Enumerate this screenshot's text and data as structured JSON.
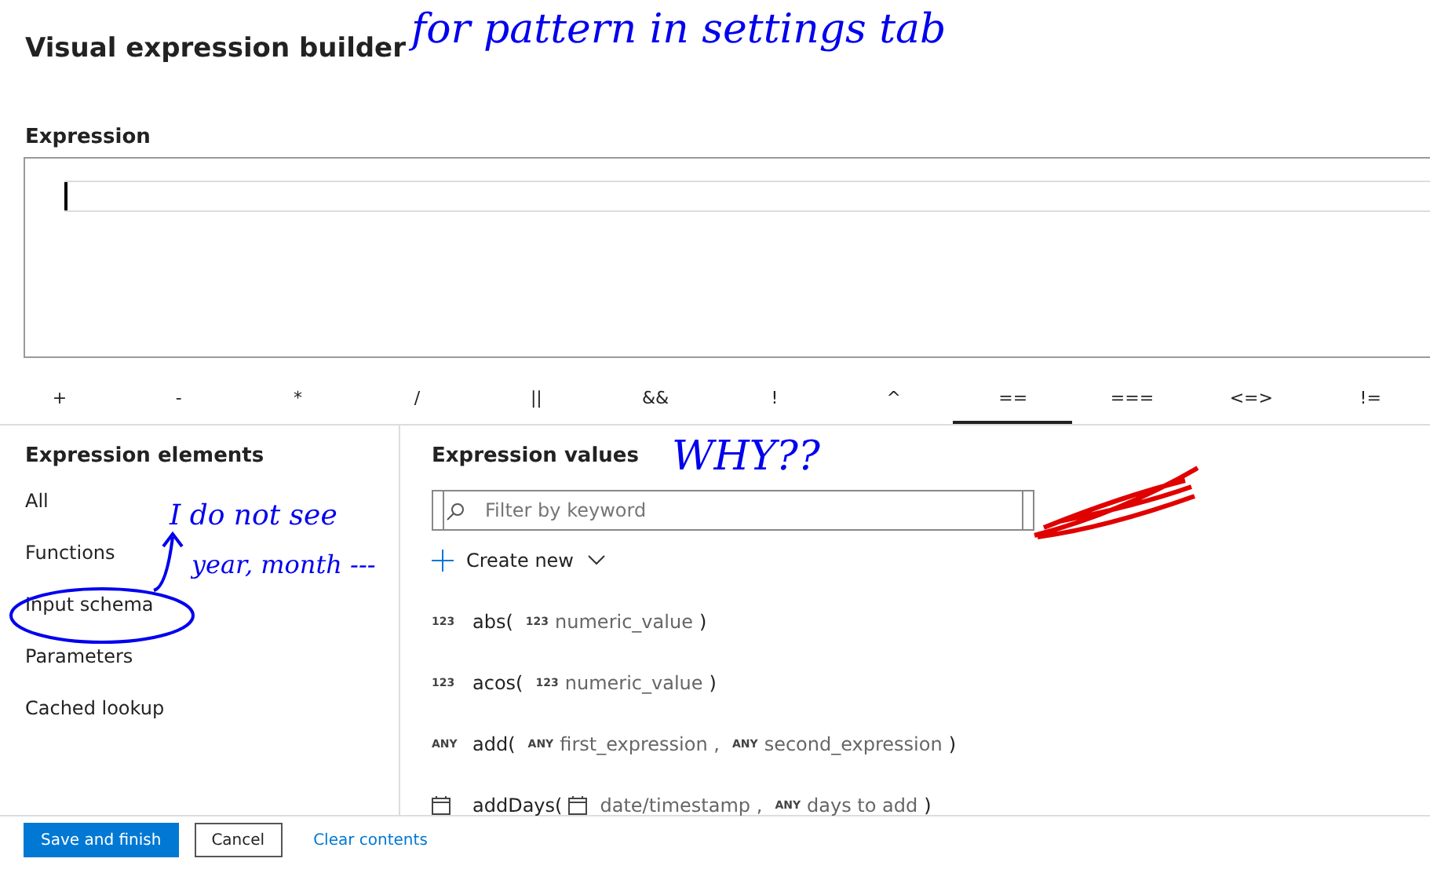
{
  "title": "Visual expression builder",
  "expression": {
    "label": "Expression"
  },
  "operators": [
    {
      "label": "+",
      "selected": false
    },
    {
      "label": "-",
      "selected": false
    },
    {
      "label": "*",
      "selected": false
    },
    {
      "label": "/",
      "selected": false
    },
    {
      "label": "||",
      "selected": false
    },
    {
      "label": "&&",
      "selected": false
    },
    {
      "label": "!",
      "selected": false
    },
    {
      "label": "^",
      "selected": false
    },
    {
      "label": "==",
      "selected": true
    },
    {
      "label": "===",
      "selected": false
    },
    {
      "label": "<=>",
      "selected": false
    },
    {
      "label": "!=",
      "selected": false
    }
  ],
  "elements": {
    "heading": "Expression elements",
    "items": [
      {
        "label": "All",
        "selected": false
      },
      {
        "label": "Functions",
        "selected": false
      },
      {
        "label": "Input schema",
        "selected": false
      },
      {
        "label": "Parameters",
        "selected": false
      },
      {
        "label": "Cached lookup",
        "selected": false
      }
    ]
  },
  "values": {
    "heading": "Expression values",
    "search": {
      "placeholder": "Filter by keyword"
    },
    "create": "Create new",
    "functions": [
      {
        "kind": "number",
        "badge": "123",
        "name": "abs(",
        "args": [
          {
            "kind": "number",
            "badge": "123",
            "name": "numeric_value"
          }
        ],
        "close": ")"
      },
      {
        "kind": "number",
        "badge": "123",
        "name": "acos(",
        "args": [
          {
            "kind": "number",
            "badge": "123",
            "name": "numeric_value"
          }
        ],
        "close": ")"
      },
      {
        "kind": "any",
        "badge": "ANY",
        "name": "add(",
        "args": [
          {
            "kind": "any",
            "badge": "ANY",
            "name": "first_expression ,"
          },
          {
            "kind": "any",
            "badge": "ANY",
            "name": "second_expression"
          }
        ],
        "close": ")"
      },
      {
        "kind": "date",
        "name": "addDays(",
        "args": [
          {
            "kind": "date",
            "name": "date/timestamp ,"
          },
          {
            "kind": "any",
            "badge": "ANY",
            "name": "days to add"
          }
        ],
        "close": ")"
      }
    ]
  },
  "buttons": [
    {
      "label": "Save and finish",
      "kind": "primary"
    },
    {
      "label": "Cancel",
      "kind": "secondary"
    },
    {
      "label": "Clear contents",
      "kind": "link"
    }
  ],
  "annotations": [
    {
      "text": "for pattern in settings tab",
      "color": "#0000ee"
    },
    {
      "text": "I do not see",
      "color": "#0000ee"
    },
    {
      "text": "year, month ---",
      "color": "#0000ee"
    },
    {
      "text": "WHY??",
      "color": "#0000ee"
    }
  ]
}
